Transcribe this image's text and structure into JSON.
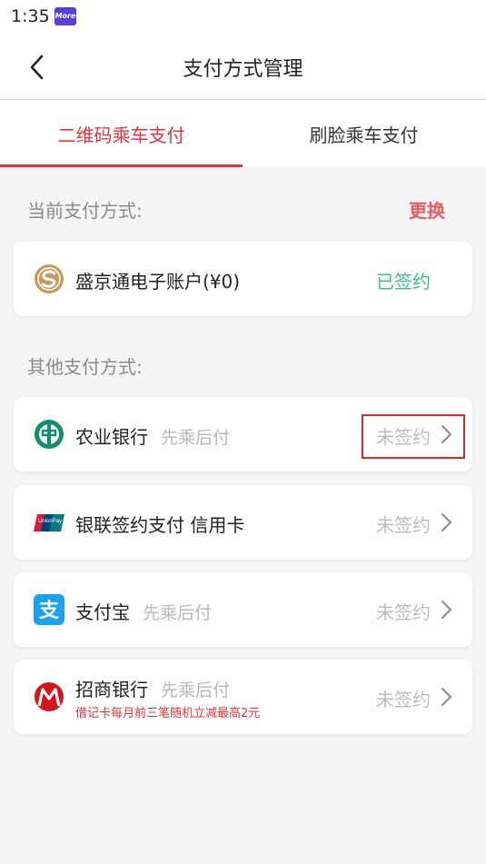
{
  "status_bar": {
    "time": "1:35",
    "badge": "More"
  },
  "nav": {
    "title": "支付方式管理"
  },
  "tabs": [
    {
      "label": "二维码乘车支付",
      "active": true
    },
    {
      "label": "刷脸乘车支付",
      "active": false
    }
  ],
  "current": {
    "label": "当前支付方式:",
    "change": "更换",
    "method": {
      "name": "盛京通电子账户(¥0)",
      "status": "已签约",
      "icon": "shengjingtong-logo-icon"
    }
  },
  "others": {
    "label": "其他支付方式:",
    "methods": [
      {
        "name": "农业银行",
        "sub": "先乘后付",
        "status": "未签约",
        "icon": "abc-bank-logo-icon"
      },
      {
        "name": "银联签约支付 信用卡",
        "sub": "",
        "status": "未签约",
        "icon": "unionpay-logo-icon",
        "icon_text": "UnionPay 银联"
      },
      {
        "name": "支付宝",
        "sub": "先乘后付",
        "status": "未签约",
        "icon": "alipay-logo-icon",
        "icon_text": "支"
      },
      {
        "name": "招商银行",
        "sub": "先乘后付",
        "promo": "借记卡每月前三笔随机立减最高2元",
        "status": "未签约",
        "icon": "cmb-logo-icon"
      }
    ]
  },
  "colors": {
    "accent": "#e8323c",
    "signed": "#3ac28a",
    "muted": "#bcbcbc"
  }
}
